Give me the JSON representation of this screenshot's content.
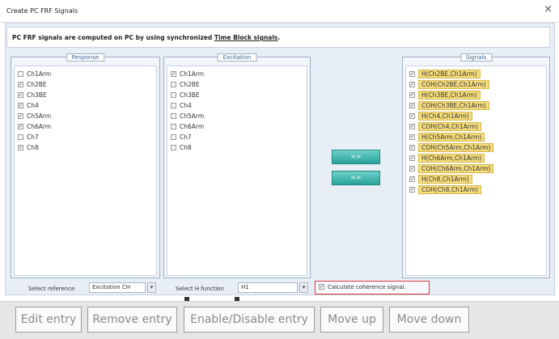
{
  "window": {
    "title": "Create PC FRF Signals",
    "close_glyph": "×"
  },
  "info": {
    "text_pre": "PC FRF signals are computed on PC by using synchronized ",
    "link": "Time Block signals",
    "text_post": "."
  },
  "response": {
    "legend": "Response",
    "items": [
      {
        "label": "Ch1Arm",
        "checked": false
      },
      {
        "label": "Ch2BE",
        "checked": true
      },
      {
        "label": "Ch3BE",
        "checked": true
      },
      {
        "label": "Ch4",
        "checked": true
      },
      {
        "label": "Ch5Arm",
        "checked": true
      },
      {
        "label": "Ch6Arm",
        "checked": true
      },
      {
        "label": "Ch7",
        "checked": false
      },
      {
        "label": "Ch8",
        "checked": true
      }
    ]
  },
  "excitation": {
    "legend": "Excitation",
    "items": [
      {
        "label": "Ch1Arm",
        "checked": true
      },
      {
        "label": "Ch2BE",
        "checked": false
      },
      {
        "label": "Ch3BE",
        "checked": false
      },
      {
        "label": "Ch4",
        "checked": false
      },
      {
        "label": "Ch5Arm",
        "checked": false
      },
      {
        "label": "Ch6Arm",
        "checked": false
      },
      {
        "label": "Ch7",
        "checked": false
      },
      {
        "label": "Ch8",
        "checked": false
      }
    ]
  },
  "buttons": {
    "add": ">>",
    "remove": "<<"
  },
  "signals": {
    "legend": "Signals",
    "items": [
      {
        "label": "H(Ch2BE,Ch1Arm)",
        "checked": true
      },
      {
        "label": "COH(Ch2BE,Ch1Arm)",
        "checked": true
      },
      {
        "label": "H(Ch3BE,Ch1Arm)",
        "checked": true
      },
      {
        "label": "COH(Ch3BE,Ch1Arm)",
        "checked": true
      },
      {
        "label": "H(Ch4,Ch1Arm)",
        "checked": true
      },
      {
        "label": "COH(Ch4,Ch1Arm)",
        "checked": true
      },
      {
        "label": "H(Ch5Arm,Ch1Arm)",
        "checked": true
      },
      {
        "label": "COH(Ch5Arm,Ch1Arm)",
        "checked": true
      },
      {
        "label": "H(Ch6Arm,Ch1Arm)",
        "checked": true
      },
      {
        "label": "COH(Ch6Arm,Ch1Arm)",
        "checked": true
      },
      {
        "label": "H(Ch8,Ch1Arm)",
        "checked": true
      },
      {
        "label": "COH(Ch8,Ch1Arm)",
        "checked": true
      }
    ]
  },
  "footer": {
    "ref_label": "Select reference",
    "ref_value": "Excitation CH",
    "hf_label": "Select H function",
    "hf_value": "H1",
    "coherence_label": "Calculate coherence signal.",
    "coherence_checked": true,
    "dropdown_glyph": "▾"
  },
  "toolbar": {
    "edit": "Edit entry",
    "remove": "Remove entry",
    "toggle": "Enable/Disable entry",
    "up": "Move up",
    "down": "Move down"
  },
  "colors": {
    "accent": "#28a39a",
    "signal_highlight": "#f5dc7c",
    "highlight_border": "#d63a3a"
  }
}
